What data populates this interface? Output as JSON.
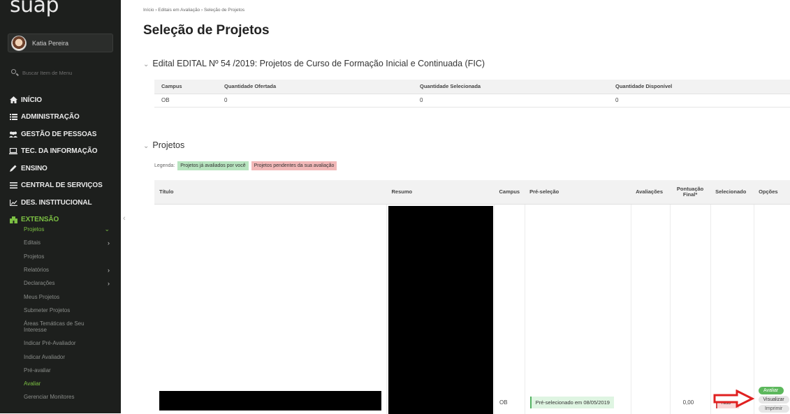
{
  "sidebar": {
    "logo": "suap",
    "user_name": "Katia Pereira",
    "search_placeholder": "Buscar Item de Menu",
    "nav": [
      {
        "label": "INÍCIO",
        "icon": "home-icon"
      },
      {
        "label": "ADMINISTRAÇÃO",
        "icon": "list-icon"
      },
      {
        "label": "GESTÃO DE PESSOAS",
        "icon": "people-icon"
      },
      {
        "label": "TEC. DA INFORMAÇÃO",
        "icon": "laptop-icon"
      },
      {
        "label": "ENSINO",
        "icon": "pencil-icon"
      },
      {
        "label": "CENTRAL DE SERVIÇOS",
        "icon": "menu-icon"
      },
      {
        "label": "DES. INSTITUCIONAL",
        "icon": "chart-icon"
      },
      {
        "label": "EXTENSÃO",
        "icon": "building-icon"
      }
    ],
    "sub": [
      "Projetos",
      "Editais",
      "Projetos",
      "Relatórios",
      "Declarações",
      "Meus Projetos",
      "Submeter Projetos",
      "Áreas Temáticas de Seu Interesse",
      "Indicar Pré-Avaliador",
      "Indicar Avaliador",
      "Pré-avaliar",
      "Avaliar",
      "Gerenciar Monitores"
    ]
  },
  "breadcrumb": "Início › Editais em Avaliação › Seleção de Projetos",
  "page_title": "Seleção de Projetos",
  "edital_section": {
    "title": "Edital EDITAL Nº 54 /2019: Projetos de Curso de Formação Inicial e Continuada (FIC)",
    "headers": [
      "Campus",
      "Quantidade Ofertada",
      "Quantidade Selecionada",
      "Quantidade Disponível"
    ],
    "rows": [
      [
        "OB",
        "0",
        "0",
        "0"
      ]
    ]
  },
  "projetos_section": {
    "title": "Projetos",
    "legend_label": "Legenda:",
    "legend_evaluated": "Projetos já avaliados por você",
    "legend_pending": "Projetos pendentes da sua avaliação",
    "headers": [
      "Título",
      "Resumo",
      "Campus",
      "Pré-seleção",
      "Avaliações",
      "Pontuação Final*",
      "Selecionado",
      "Opções"
    ],
    "row": {
      "campus": "OB",
      "pre_selecao": "Pré-selecionado em 08/05/2019",
      "avaliacoes": "",
      "pontuacao": "0,00",
      "selecionado": "Não",
      "options": [
        "Avaliar",
        "Visualizar",
        "Imprimir"
      ]
    }
  },
  "colors": {
    "sidebar_bg": "#1d1f1d",
    "accent_green": "#7cc043",
    "legend_green": "#b7e4bf",
    "legend_red": "#f2b8b8",
    "arrow_red": "#e02020"
  }
}
